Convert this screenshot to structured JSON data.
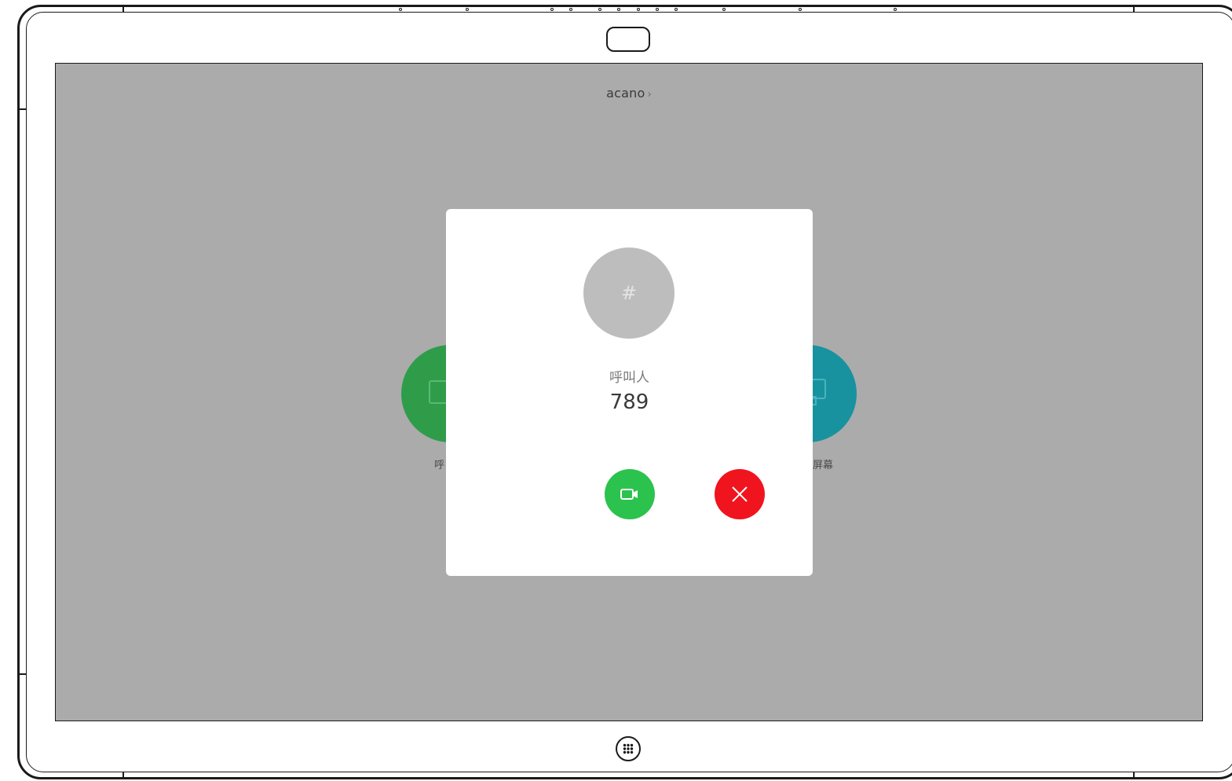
{
  "header": {
    "title": "acano",
    "chevron": "›"
  },
  "background": {
    "left_circle_color": "#2f9c4a",
    "right_circle_color": "#18929e",
    "left_label_partial": "呼",
    "right_label_partial": "屏幕"
  },
  "incoming_call": {
    "avatar_symbol": "#",
    "caller_label": "呼叫人",
    "caller_number": "789",
    "accept_button_icon": "video-camera-icon",
    "accept_color": "#2cc24e",
    "decline_button_icon": "close-icon",
    "decline_color": "#f0141e"
  },
  "device": {
    "home_button_icon": "grid-dots-icon"
  }
}
